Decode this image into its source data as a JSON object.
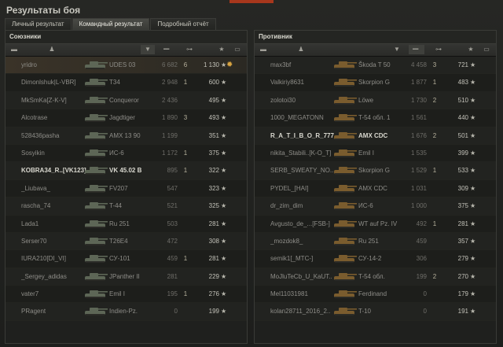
{
  "window": {
    "title": "Результаты боя"
  },
  "tabs": [
    {
      "label": "Личный результат",
      "active": false
    },
    {
      "label": "Командный результат",
      "active": true
    },
    {
      "label": "Подробный отчёт",
      "active": false
    }
  ],
  "colors": {
    "accent": "#a7371c",
    "medal": "#d8a441"
  },
  "allies": {
    "title": "Союзники",
    "rows": [
      {
        "player": "yridro",
        "vehicle": "UDES 03",
        "damage": "6 682",
        "kills": "6",
        "xp": "1 130",
        "medal": true,
        "highlight": true
      },
      {
        "player": "Dimonlshuk|L-VBR]",
        "vehicle": "T34",
        "damage": "2 948",
        "kills": "1",
        "xp": "600"
      },
      {
        "player": "MkSmKa[Z-K-V]",
        "vehicle": "Conqueror",
        "damage": "2 436",
        "kills": "",
        "xp": "495"
      },
      {
        "player": "Alcotrase",
        "vehicle": "Jagdtiger",
        "damage": "1 890",
        "kills": "3",
        "xp": "493"
      },
      {
        "player": "528436pasha",
        "vehicle": "AMX 13 90",
        "damage": "1 199",
        "kills": "",
        "xp": "351"
      },
      {
        "player": "Sosyikin",
        "vehicle": "ИС-6",
        "damage": "1 172",
        "kills": "1",
        "xp": "375"
      },
      {
        "player": "KOBRA34_R..[VK123]",
        "vehicle": "VK 45.02 B",
        "damage": "895",
        "kills": "1",
        "xp": "322",
        "bold": true
      },
      {
        "player": "_Liubava_",
        "vehicle": "FV207",
        "damage": "547",
        "kills": "",
        "xp": "323"
      },
      {
        "player": "rascha_74",
        "vehicle": "T-44",
        "damage": "521",
        "kills": "",
        "xp": "325"
      },
      {
        "player": "Lada1",
        "vehicle": "Ru 251",
        "damage": "503",
        "kills": "",
        "xp": "281"
      },
      {
        "player": "Serser70",
        "vehicle": "T26E4",
        "damage": "472",
        "kills": "",
        "xp": "308"
      },
      {
        "player": "IURA210[DI_VI]",
        "vehicle": "СУ-101",
        "damage": "459",
        "kills": "1",
        "xp": "281"
      },
      {
        "player": "_Sergey_adidas",
        "vehicle": "JPanther II",
        "damage": "281",
        "kills": "",
        "xp": "229"
      },
      {
        "player": "vater7",
        "vehicle": "Emil I",
        "damage": "195",
        "kills": "1",
        "xp": "276"
      },
      {
        "player": "PRagent",
        "vehicle": "Indien-Pz.",
        "damage": "0",
        "kills": "",
        "xp": "199"
      }
    ]
  },
  "enemies": {
    "title": "Противник",
    "rows": [
      {
        "player": "max3bf",
        "vehicle": "Škoda T 50",
        "damage": "4 458",
        "kills": "3",
        "xp": "721"
      },
      {
        "player": "Valkiriy8631",
        "vehicle": "Skorpion G",
        "damage": "1 877",
        "kills": "1",
        "xp": "483"
      },
      {
        "player": "zolotoi30",
        "vehicle": "Löwe",
        "damage": "1 730",
        "kills": "2",
        "xp": "510"
      },
      {
        "player": "1000_MEGATONN",
        "vehicle": "T-54 обл. 1",
        "damage": "1 561",
        "kills": "",
        "xp": "440"
      },
      {
        "player": "R_A_T_I_B_O_R_777",
        "vehicle": "AMX CDC",
        "damage": "1 676",
        "kills": "2",
        "xp": "501",
        "bold": true
      },
      {
        "player": "nikita_Stabili..[K-O_T]",
        "vehicle": "Emil I",
        "damage": "1 535",
        "kills": "",
        "xp": "399"
      },
      {
        "player": "SERB_SWEATY_NO..",
        "vehicle": "Skorpion G",
        "damage": "1 529",
        "kills": "1",
        "xp": "533"
      },
      {
        "player": "PYDEL_[HAI]",
        "vehicle": "AMX CDC",
        "damage": "1 031",
        "kills": "",
        "xp": "309"
      },
      {
        "player": "dr_zim_dim",
        "vehicle": "ИС-6",
        "damage": "1 000",
        "kills": "",
        "xp": "375"
      },
      {
        "player": "Avgusto_de_...[FSB-]",
        "vehicle": "WT auf Pz. IV",
        "damage": "492",
        "kills": "1",
        "xp": "281"
      },
      {
        "player": "_mozdok8_",
        "vehicle": "Ru 251",
        "damage": "459",
        "kills": "",
        "xp": "357"
      },
      {
        "player": "semik1[_MTC-]",
        "vehicle": "СУ-14-2",
        "damage": "306",
        "kills": "",
        "xp": "279"
      },
      {
        "player": "MoJluTeCb_U_KaUT..",
        "vehicle": "T-54 обл.",
        "damage": "199",
        "kills": "2",
        "xp": "270"
      },
      {
        "player": "Mel11031981",
        "vehicle": "Ferdinand",
        "damage": "0",
        "kills": "",
        "xp": "179"
      },
      {
        "player": "kolan28711_2016_2..",
        "vehicle": "T-10",
        "damage": "0",
        "kills": "",
        "xp": "191"
      }
    ]
  }
}
